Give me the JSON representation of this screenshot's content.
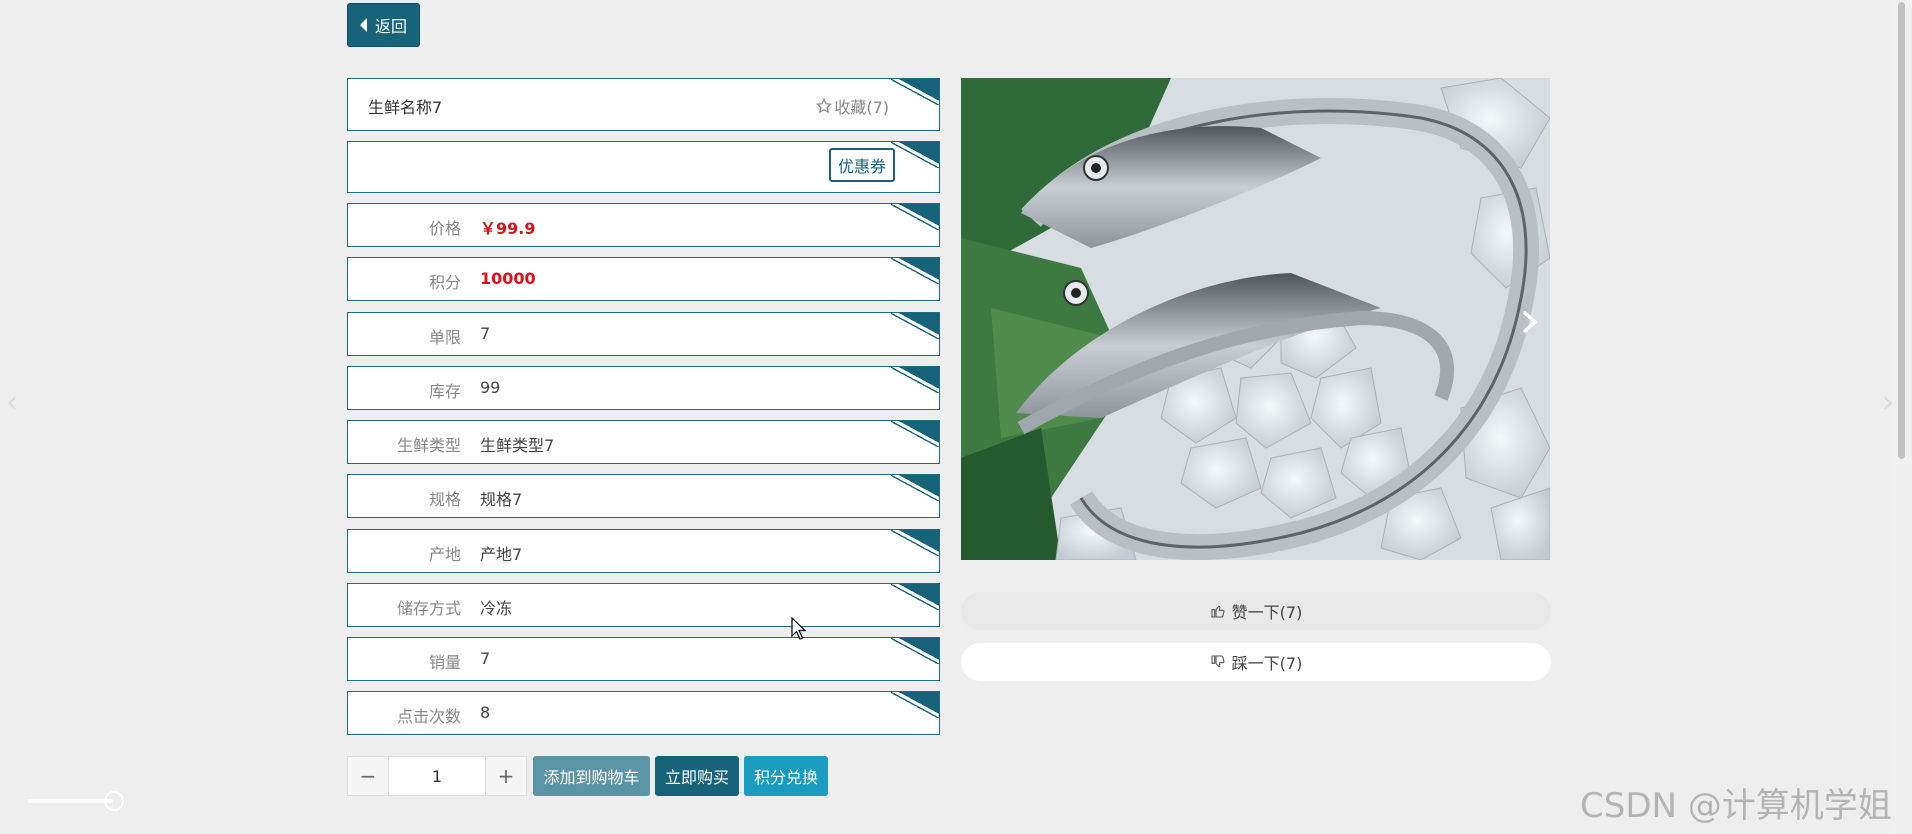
{
  "back_button": {
    "label": "返回"
  },
  "product": {
    "name": "生鲜名称7",
    "favorite_label": "收藏(7)",
    "coupon_label": "优惠券"
  },
  "fields": [
    {
      "label": "价格",
      "value": "￥99.9",
      "highlight": true
    },
    {
      "label": "积分",
      "value": "10000",
      "highlight": true
    },
    {
      "label": "单限",
      "value": "7",
      "highlight": false
    },
    {
      "label": "库存",
      "value": "99",
      "highlight": false
    },
    {
      "label": "生鲜类型",
      "value": "生鲜类型7",
      "highlight": false
    },
    {
      "label": "规格",
      "value": "规格7",
      "highlight": false
    },
    {
      "label": "产地",
      "value": "产地7",
      "highlight": false
    },
    {
      "label": "储存方式",
      "value": "冷冻",
      "highlight": false
    },
    {
      "label": "销量",
      "value": "7",
      "highlight": false
    },
    {
      "label": "点击次数",
      "value": "8",
      "highlight": false
    }
  ],
  "votes": {
    "like_label": "赞一下(7)",
    "dislike_label": "踩一下(7)"
  },
  "quantity": {
    "value": "1",
    "minus": "−",
    "plus": "+"
  },
  "actions": {
    "add_cart": "添加到购物车",
    "buy_now": "立即购买",
    "points_exchange": "积分兑换"
  },
  "watermark": "CSDN @计算机学姐",
  "colors": {
    "accent": "#17647a",
    "price_red": "#e0101a",
    "add_cart_bg": "#5a95a5",
    "buy_now_bg": "#17647a",
    "points_bg": "#1a9bc0"
  }
}
